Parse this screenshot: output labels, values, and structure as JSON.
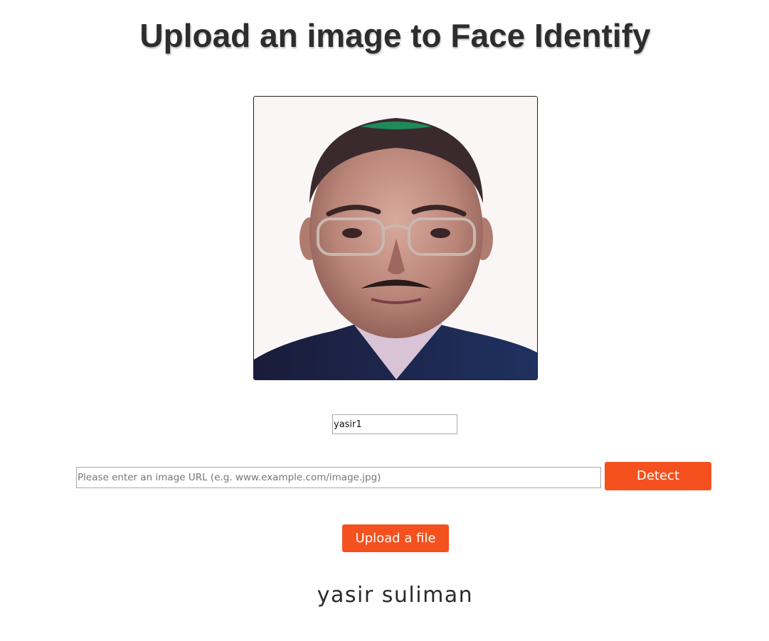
{
  "header": {
    "title": "Upload an image to Face Identify"
  },
  "photo": {
    "icon": "face-portrait-photo"
  },
  "name_field": {
    "value": "yasir1"
  },
  "url_field": {
    "value": "",
    "placeholder": "Please enter an image URL (e.g. www.example.com/image.jpg)"
  },
  "buttons": {
    "detect_label": "Detect",
    "upload_label": "Upload a file"
  },
  "result": {
    "name": "yasir suliman"
  },
  "colors": {
    "accent": "#f4511e",
    "title": "#2d2d2d"
  }
}
